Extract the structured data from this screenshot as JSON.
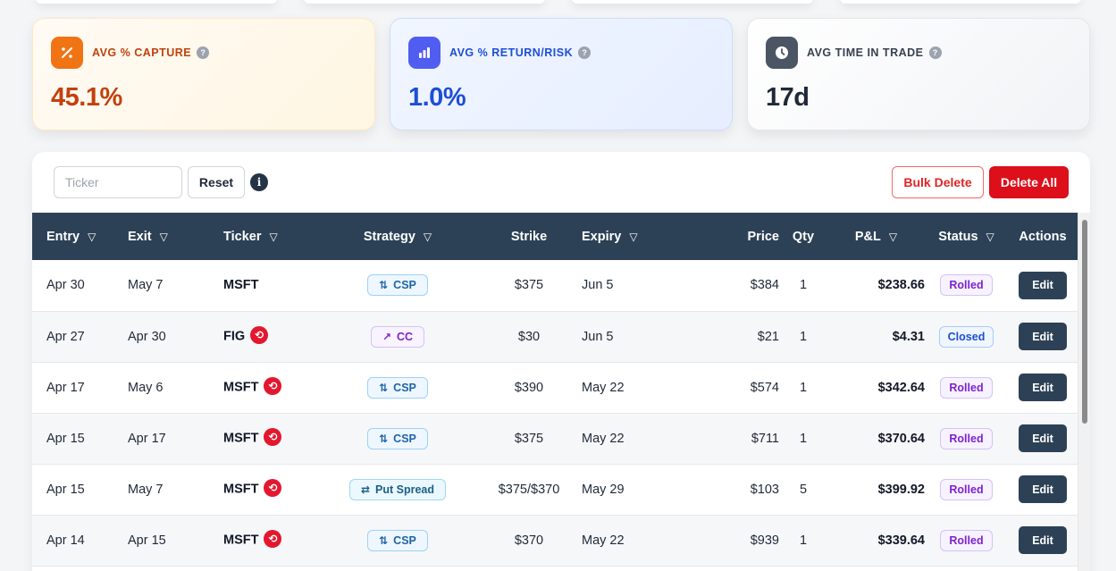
{
  "stats": [
    {
      "id": "capture",
      "label": "AVG % CAPTURE",
      "value": "45.1%",
      "icon": "percent-icon"
    },
    {
      "id": "retrisk",
      "label": "AVG % RETURN/RISK",
      "value": "1.0%",
      "icon": "bar-chart-icon"
    },
    {
      "id": "time",
      "label": "AVG TIME IN TRADE",
      "value": "17d",
      "icon": "clock-icon"
    }
  ],
  "toolbar": {
    "ticker_placeholder": "Ticker",
    "ticker_value": "",
    "reset_label": "Reset",
    "info_label": "i",
    "bulk_delete_label": "Bulk Delete",
    "delete_all_label": "Delete All"
  },
  "table": {
    "columns": [
      "Entry",
      "Exit",
      "Ticker",
      "Strategy",
      "Strike",
      "Expiry",
      "Price",
      "Qty",
      "P&L",
      "Status",
      "Actions"
    ],
    "filter_icon": "▽",
    "rows": [
      {
        "entry": "Apr 30",
        "exit": "May 7",
        "ticker": "MSFT",
        "rolled_icon": false,
        "strategy": "CSP",
        "strategy_kind": "csp",
        "strike": "$375",
        "expiry": "Jun 5",
        "price": "$384",
        "qty": "1",
        "pnl": "$238.66",
        "status": "Rolled",
        "action": "Edit"
      },
      {
        "entry": "Apr 27",
        "exit": "Apr 30",
        "ticker": "FIG",
        "rolled_icon": true,
        "strategy": "CC",
        "strategy_kind": "cc",
        "strike": "$30",
        "expiry": "Jun 5",
        "price": "$21",
        "qty": "1",
        "pnl": "$4.31",
        "status": "Closed",
        "action": "Edit"
      },
      {
        "entry": "Apr 17",
        "exit": "May 6",
        "ticker": "MSFT",
        "rolled_icon": true,
        "strategy": "CSP",
        "strategy_kind": "csp",
        "strike": "$390",
        "expiry": "May 22",
        "price": "$574",
        "qty": "1",
        "pnl": "$342.64",
        "status": "Rolled",
        "action": "Edit"
      },
      {
        "entry": "Apr 15",
        "exit": "Apr 17",
        "ticker": "MSFT",
        "rolled_icon": true,
        "strategy": "CSP",
        "strategy_kind": "csp",
        "strike": "$375",
        "expiry": "May 22",
        "price": "$711",
        "qty": "1",
        "pnl": "$370.64",
        "status": "Rolled",
        "action": "Edit"
      },
      {
        "entry": "Apr 15",
        "exit": "May 7",
        "ticker": "MSFT",
        "rolled_icon": true,
        "strategy": "Put Spread",
        "strategy_kind": "spread",
        "strike": "$375/$370",
        "expiry": "May 29",
        "price": "$103",
        "qty": "5",
        "pnl": "$399.92",
        "status": "Rolled",
        "action": "Edit"
      },
      {
        "entry": "Apr 14",
        "exit": "Apr 15",
        "ticker": "MSFT",
        "rolled_icon": true,
        "strategy": "CSP",
        "strategy_kind": "csp",
        "strike": "$370",
        "expiry": "May 22",
        "price": "$939",
        "qty": "1",
        "pnl": "$339.64",
        "status": "Rolled",
        "action": "Edit"
      }
    ]
  }
}
